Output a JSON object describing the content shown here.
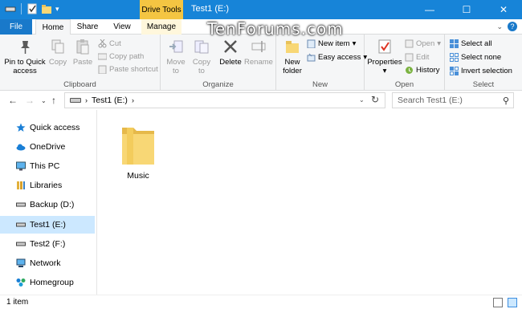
{
  "titlebar": {
    "context_tab": "Drive Tools",
    "title": "Test1 (E:)",
    "watermark": "TenForums.com",
    "minimize": "—",
    "maximize": "☐",
    "close": "✕"
  },
  "tabs": {
    "file": "File",
    "home": "Home",
    "share": "Share",
    "view": "View",
    "manage": "Manage"
  },
  "ribbon": {
    "clipboard": {
      "label": "Clipboard",
      "pin": "Pin to Quick access",
      "copy": "Copy",
      "paste": "Paste",
      "cut": "Cut",
      "copy_path": "Copy path",
      "paste_shortcut": "Paste shortcut"
    },
    "organize": {
      "label": "Organize",
      "move_to": "Move to",
      "copy_to": "Copy to",
      "delete": "Delete",
      "rename": "Rename"
    },
    "new": {
      "label": "New",
      "new_folder": "New folder",
      "new_item": "New item",
      "easy_access": "Easy access"
    },
    "open": {
      "label": "Open",
      "properties": "Properties",
      "open": "Open",
      "edit": "Edit",
      "history": "History"
    },
    "select": {
      "label": "Select",
      "select_all": "Select all",
      "select_none": "Select none",
      "invert_selection": "Invert selection"
    }
  },
  "address": {
    "path": "Test1 (E:)",
    "search_placeholder": "Search Test1 (E:)"
  },
  "nav": {
    "items": [
      {
        "label": "Quick access"
      },
      {
        "label": "OneDrive"
      },
      {
        "label": "This PC"
      },
      {
        "label": "Libraries"
      },
      {
        "label": "Backup (D:)"
      },
      {
        "label": "Test1 (E:)"
      },
      {
        "label": "Test2 (F:)"
      },
      {
        "label": "Network"
      },
      {
        "label": "Homegroup"
      }
    ]
  },
  "content": {
    "items": [
      {
        "name": "Music"
      }
    ]
  },
  "status": {
    "count": "1 item"
  },
  "colors": {
    "titlebar": "#1784d8",
    "file_tab": "#1979ca",
    "drive_tools": "#f4c542",
    "selection": "#cce8ff",
    "folder": "#f8d775"
  }
}
